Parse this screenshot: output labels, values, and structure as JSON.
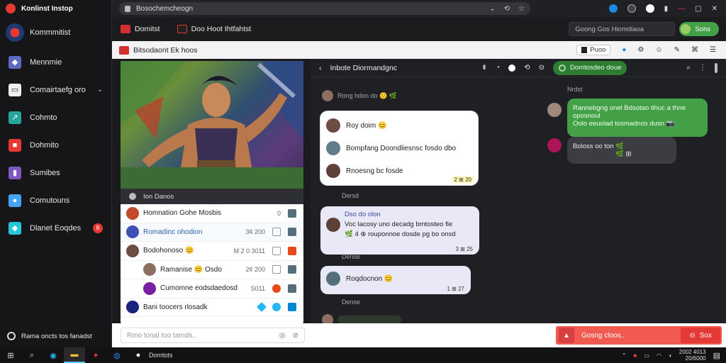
{
  "app": {
    "title": "Konlinst Instop",
    "brand": "Kommmitist"
  },
  "sidebar": {
    "items": [
      {
        "label": "Mennmie",
        "icon": "shield-icon",
        "color": "#5c6bc0"
      },
      {
        "label": "Comairtaefg oro",
        "icon": "folder-icon",
        "color": "#eeeeee",
        "chevron": "⌄"
      },
      {
        "label": "Cohmto",
        "icon": "chart-icon",
        "color": "#26a69a"
      },
      {
        "label": "Dohmito",
        "icon": "gift-icon",
        "color": "#e53935"
      },
      {
        "label": "Sumibes",
        "icon": "book-icon",
        "color": "#7e57c2"
      },
      {
        "label": "Comutouns",
        "icon": "people-icon",
        "color": "#42a5f5"
      },
      {
        "label": "Dlanet Eoqdes",
        "icon": "diamond-icon",
        "color": "#26c6da",
        "badge": "8"
      }
    ],
    "footer": "Rama oncts tos fanadst"
  },
  "browser": {
    "url": "Bosochemcheogn",
    "icons_right": [
      "⌄",
      "⟲",
      "☆"
    ]
  },
  "tabs": [
    {
      "label": "Domitst"
    },
    {
      "label": "Doo Hoot Ihtfahtst"
    }
  ],
  "header_search": {
    "placeholder": "Goong Gos Hiomdiaoa"
  },
  "header_button": {
    "label": "Sohs"
  },
  "toolrow": {
    "title": "Bitsodaont Ek hoos",
    "chip": "Puoo"
  },
  "hero": {
    "caption": "Ion Danos"
  },
  "list": [
    {
      "name": "Homnation Gohe Mosbis",
      "meta": "0",
      "color": "#c24b2a"
    },
    {
      "name": "Romadinc ohodion",
      "meta": "3¢ 200",
      "color": "#3f51b5",
      "name_color": "#2e5fa8"
    },
    {
      "name": "Bodohonoso 😊",
      "meta": "M 2 0 3011",
      "color": "#6d4c41"
    },
    {
      "name": "Ramanise 😊 Osdo",
      "meta": "2¢ 200",
      "color": "#8d6e63",
      "indent": true
    },
    {
      "name": "Cumomne eodsdaedosd",
      "meta": "S011",
      "color": "#7b1fa2",
      "indent": true
    },
    {
      "name": "Bani toocers rlosadk",
      "meta": "",
      "color": "#1a237e"
    }
  ],
  "chat": {
    "title": "Inbote Diormandgnc",
    "pill": "Domtosdeo doue",
    "messages": [
      {
        "text": "Rong hdon do 🙂 🌿",
        "type": "sys"
      },
      {
        "lines": [
          "Roy doim 😊",
          "Bompfang Doondliesnsc fosdo dbo",
          "Rnoesng bc fosde"
        ],
        "stamp": "2 ⊞ 20"
      },
      {
        "text": "Dersd",
        "type": "sys"
      },
      {
        "lines": [
          "Dso do olon",
          "Voc lacosy uno decadg bmtosteo fie",
          "🌿 4 ⊕ rouponnoe dosde pg bo onsd"
        ],
        "stamp": "3 ⊞ 25"
      },
      {
        "text": "Dense",
        "type": "sys"
      },
      {
        "lines": [
          "Roqdocnon 😊"
        ],
        "stamp": "1 ⊞ 27"
      },
      {
        "text": "Dense",
        "type": "sys"
      }
    ],
    "right": {
      "time": "Nrdst",
      "green_bubble": [
        "Rannebgng onel Bdsotao tihuc a thne",
        "oposnoul",
        "Oolo eeuolad tosmadnos dusn 📷"
      ],
      "dark_bubble": [
        "Boloss oo ton 🌿",
        "🌿 ⊞"
      ]
    }
  },
  "composer": {
    "placeholder": "Rmo tonal too tamds..",
    "red_bar": "Gosng cloos..",
    "red_btn": "Sox"
  },
  "taskbar": {
    "app_label": "Domtots",
    "clock_line1": "2002 4013",
    "clock_line2": "20/6000"
  }
}
